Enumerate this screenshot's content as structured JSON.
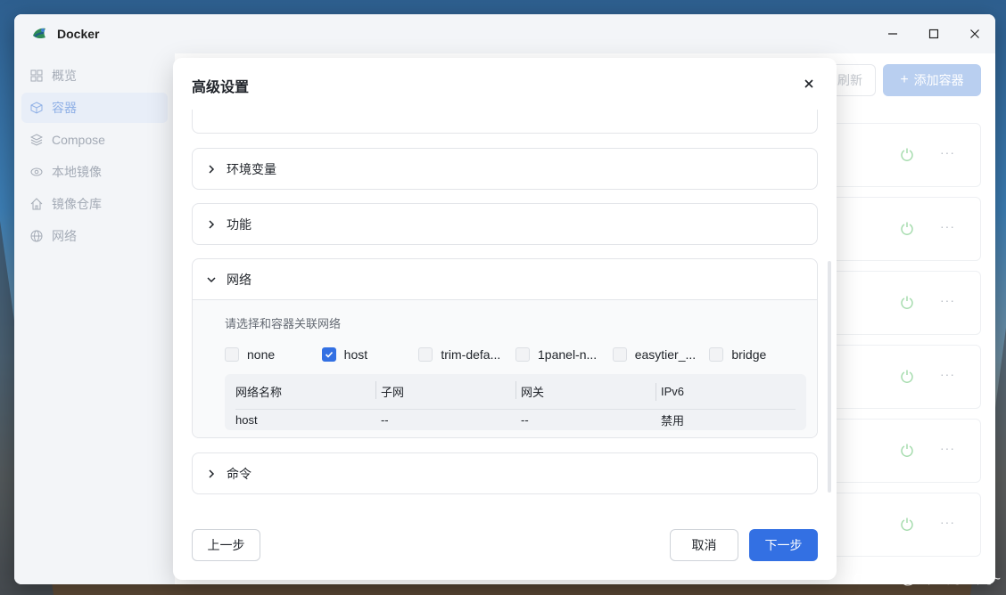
{
  "window": {
    "title": "Docker"
  },
  "sidebar": {
    "items": [
      {
        "label": "概览",
        "icon": "grid-icon",
        "active": false
      },
      {
        "label": "容器",
        "icon": "cube-icon",
        "active": true
      },
      {
        "label": "Compose",
        "icon": "layers-icon",
        "active": false
      },
      {
        "label": "本地镜像",
        "icon": "eye-icon",
        "active": false
      },
      {
        "label": "镜像仓库",
        "icon": "home-icon",
        "active": false
      },
      {
        "label": "网络",
        "icon": "globe-icon",
        "active": false
      }
    ]
  },
  "toolbar": {
    "refresh_label": "刷新",
    "add_label": "添加容器"
  },
  "dialog": {
    "title": "高级设置",
    "sections": {
      "env": {
        "label": "环境变量"
      },
      "capabilities": {
        "label": "功能"
      },
      "network": {
        "label": "网络",
        "hint": "请选择和容器关联网络",
        "options": [
          {
            "label": "none",
            "checked": false
          },
          {
            "label": "host",
            "checked": true
          },
          {
            "label": "trim-defa...",
            "checked": false
          },
          {
            "label": "1panel-n...",
            "checked": false
          },
          {
            "label": "easytier_...",
            "checked": false
          },
          {
            "label": "bridge",
            "checked": false
          }
        ],
        "table": {
          "headers": [
            "网络名称",
            "子网",
            "网关",
            "IPv6"
          ],
          "rows": [
            [
              "host",
              "--",
              "--",
              "禁用"
            ]
          ]
        }
      },
      "command": {
        "label": "命令"
      }
    },
    "footer": {
      "prev_label": "上一步",
      "cancel_label": "取消",
      "next_label": "下一步"
    }
  },
  "watermark": "CSDN @会飞的鱼儿~",
  "colors": {
    "primary": "#3370e3",
    "power_icon": "#a6dcae"
  }
}
